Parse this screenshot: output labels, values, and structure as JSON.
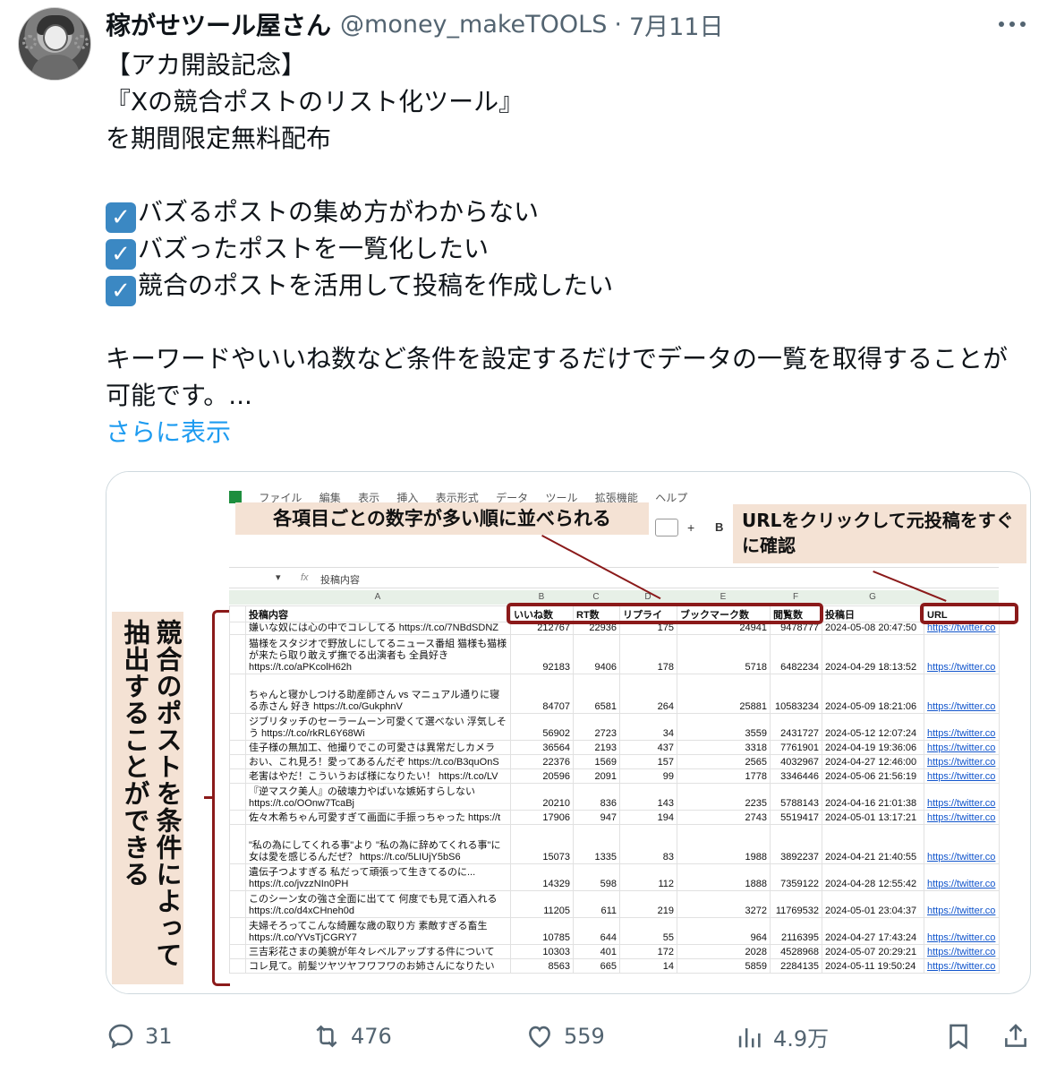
{
  "author": {
    "name": "稼がせツール屋さん",
    "handle": "@money_makeTOOLS",
    "separator": "·",
    "date": "7月11日"
  },
  "post": {
    "lines": [
      "【アカ開設記念】",
      "『Xの競合ポストのリスト化ツール』",
      "を期間限定無料配布"
    ],
    "checks": [
      "バズるポストの集め方がわからない",
      "バズったポストを一覧化したい",
      "競合のポストを活用して投稿を作成したい"
    ],
    "check_glyph": "✓",
    "paragraph": "キーワードやいいね数など条件を設定するだけでデータの一覧を取得することが可能です。...",
    "show_more": "さらに表示"
  },
  "image": {
    "callout_top": "各項目ごとの数字が多い順に並べられる",
    "callout_url": "URLをクリックして元投稿をすぐに確認",
    "callout_side": "競合のポストを条件によって抽出することができる",
    "menu": [
      "ファイル",
      "編集",
      "表示",
      "挿入",
      "表示形式",
      "データ",
      "ツール",
      "拡張機能",
      "ヘルプ"
    ],
    "toolbar_plus": "+",
    "toolbar_b": "B",
    "formula_ref": "▾",
    "formula_fx": "fx",
    "formula_content": "投稿内容",
    "col_letters": [
      "A",
      "B",
      "C",
      "D",
      "E",
      "F",
      "G"
    ],
    "headers": [
      "投稿内容",
      "いいね数",
      "RT数",
      "リプライ",
      "ブックマーク数",
      "閲覧数",
      "投稿日",
      "URL"
    ],
    "rows": [
      {
        "text": "嫌いな奴には心の中でコレしてる https://t.co/7NBdSDNZ",
        "likes": "212767",
        "rt": "22936",
        "reply": "175",
        "bookmark": "24941",
        "views": "9478777",
        "date": "2024-05-08 20:47:50",
        "url": "https://twitter.co"
      },
      {
        "text": "猫様をスタジオで野放しにしてるニュース番組 猫様も猫様が来たら取り敢えず撫でる出演者も 全員好き https://t.co/aPKcolH62h",
        "likes": "92183",
        "rt": "9406",
        "reply": "178",
        "bookmark": "5718",
        "views": "6482234",
        "date": "2024-04-29 18:13:52",
        "url": "https://twitter.co"
      },
      {
        "text": "ちゃんと寝かしつける助産師さん vs マニュアル通りに寝る赤さん 好き https://t.co/GukphnV",
        "likes": "84707",
        "rt": "6581",
        "reply": "264",
        "bookmark": "25881",
        "views": "10583234",
        "date": "2024-05-09 18:21:06",
        "url": "https://twitter.co"
      },
      {
        "text": "ジブリタッチのセーラームーン可愛くて選べない 浮気しそう https://t.co/rkRL6Y68Wi",
        "likes": "56902",
        "rt": "2723",
        "reply": "34",
        "bookmark": "3559",
        "views": "2431727",
        "date": "2024-05-12 12:07:24",
        "url": "https://twitter.co"
      },
      {
        "text": "佳子様の無加工、他撮りでこの可愛さは異常だしカメラ",
        "likes": "36564",
        "rt": "2193",
        "reply": "437",
        "bookmark": "3318",
        "views": "7761901",
        "date": "2024-04-19 19:36:06",
        "url": "https://twitter.co"
      },
      {
        "text": "おい、これ見ろ！愛ってあるんだぞ https://t.co/B3quOnS",
        "likes": "22376",
        "rt": "1569",
        "reply": "157",
        "bookmark": "2565",
        "views": "4032967",
        "date": "2024-04-27 12:46:00",
        "url": "https://twitter.co"
      },
      {
        "text": "老害はやだ！こういうおば様になりたい！ https://t.co/LV",
        "likes": "20596",
        "rt": "2091",
        "reply": "99",
        "bookmark": "1778",
        "views": "3346446",
        "date": "2024-05-06 21:56:19",
        "url": "https://twitter.co"
      },
      {
        "text": "『逆マスク美人』の破壊力やばいな嫉妬すらしない https://t.co/OOnw7TcaBj",
        "likes": "20210",
        "rt": "836",
        "reply": "143",
        "bookmark": "2235",
        "views": "5788143",
        "date": "2024-04-16 21:01:38",
        "url": "https://twitter.co"
      },
      {
        "text": "佐々木希ちゃん可愛すぎて画面に手振っちゃった https://t",
        "likes": "17906",
        "rt": "947",
        "reply": "194",
        "bookmark": "2743",
        "views": "5519417",
        "date": "2024-05-01 13:17:21",
        "url": "https://twitter.co"
      },
      {
        "text": "\"私の為にしてくれる事\"より \"私の為に辞めてくれる事\"に女は愛を感じるんだぜ？ https://t.co/5LIUjY5bS6",
        "likes": "15073",
        "rt": "1335",
        "reply": "83",
        "bookmark": "1988",
        "views": "3892237",
        "date": "2024-04-21 21:40:55",
        "url": "https://twitter.co"
      },
      {
        "text": "遺伝子つよすぎる 私だって頑張って生きてるのに... https://t.co/jvzzNIn0PH",
        "likes": "14329",
        "rt": "598",
        "reply": "112",
        "bookmark": "1888",
        "views": "7359122",
        "date": "2024-04-28 12:55:42",
        "url": "https://twitter.co"
      },
      {
        "text": "このシーン女の強さ全面に出てて 何度でも見て酒入れる https://t.co/d4xCHneh0d",
        "likes": "11205",
        "rt": "611",
        "reply": "219",
        "bookmark": "3272",
        "views": "11769532",
        "date": "2024-05-01 23:04:37",
        "url": "https://twitter.co"
      },
      {
        "text": "夫婦そろってこんな綺麗な歳の取り方 素敵すぎる畜生 https://t.co/YVsTjCGRY7",
        "likes": "10785",
        "rt": "644",
        "reply": "55",
        "bookmark": "964",
        "views": "2116395",
        "date": "2024-04-27 17:43:24",
        "url": "https://twitter.co"
      },
      {
        "text": "三吉彩花さまの美貌が年々レベルアップする件について",
        "likes": "10303",
        "rt": "401",
        "reply": "172",
        "bookmark": "2028",
        "views": "4528968",
        "date": "2024-05-07 20:29:21",
        "url": "https://twitter.co"
      },
      {
        "text": "コレ見て。前髪ツヤツヤフワフワのお姉さんになりたい",
        "likes": "8563",
        "rt": "665",
        "reply": "14",
        "bookmark": "5859",
        "views": "2284135",
        "date": "2024-05-11 19:50:24",
        "url": "https://twitter.co"
      }
    ]
  },
  "actions": {
    "replies": "31",
    "reposts": "476",
    "likes": "559",
    "views": "4.9万"
  },
  "icons": {
    "more": "more-dots-icon",
    "reply": "reply-bubble-icon",
    "repost": "repost-arrows-icon",
    "like": "heart-icon",
    "views": "bar-chart-icon",
    "bookmark": "bookmark-icon",
    "share": "share-upload-icon"
  },
  "colors": {
    "link": "#1d9bf0",
    "muted": "#536471",
    "callout_bg": "#f4e2d4",
    "callout_border": "#8b1a1a",
    "check_bg": "#3b88c3"
  }
}
